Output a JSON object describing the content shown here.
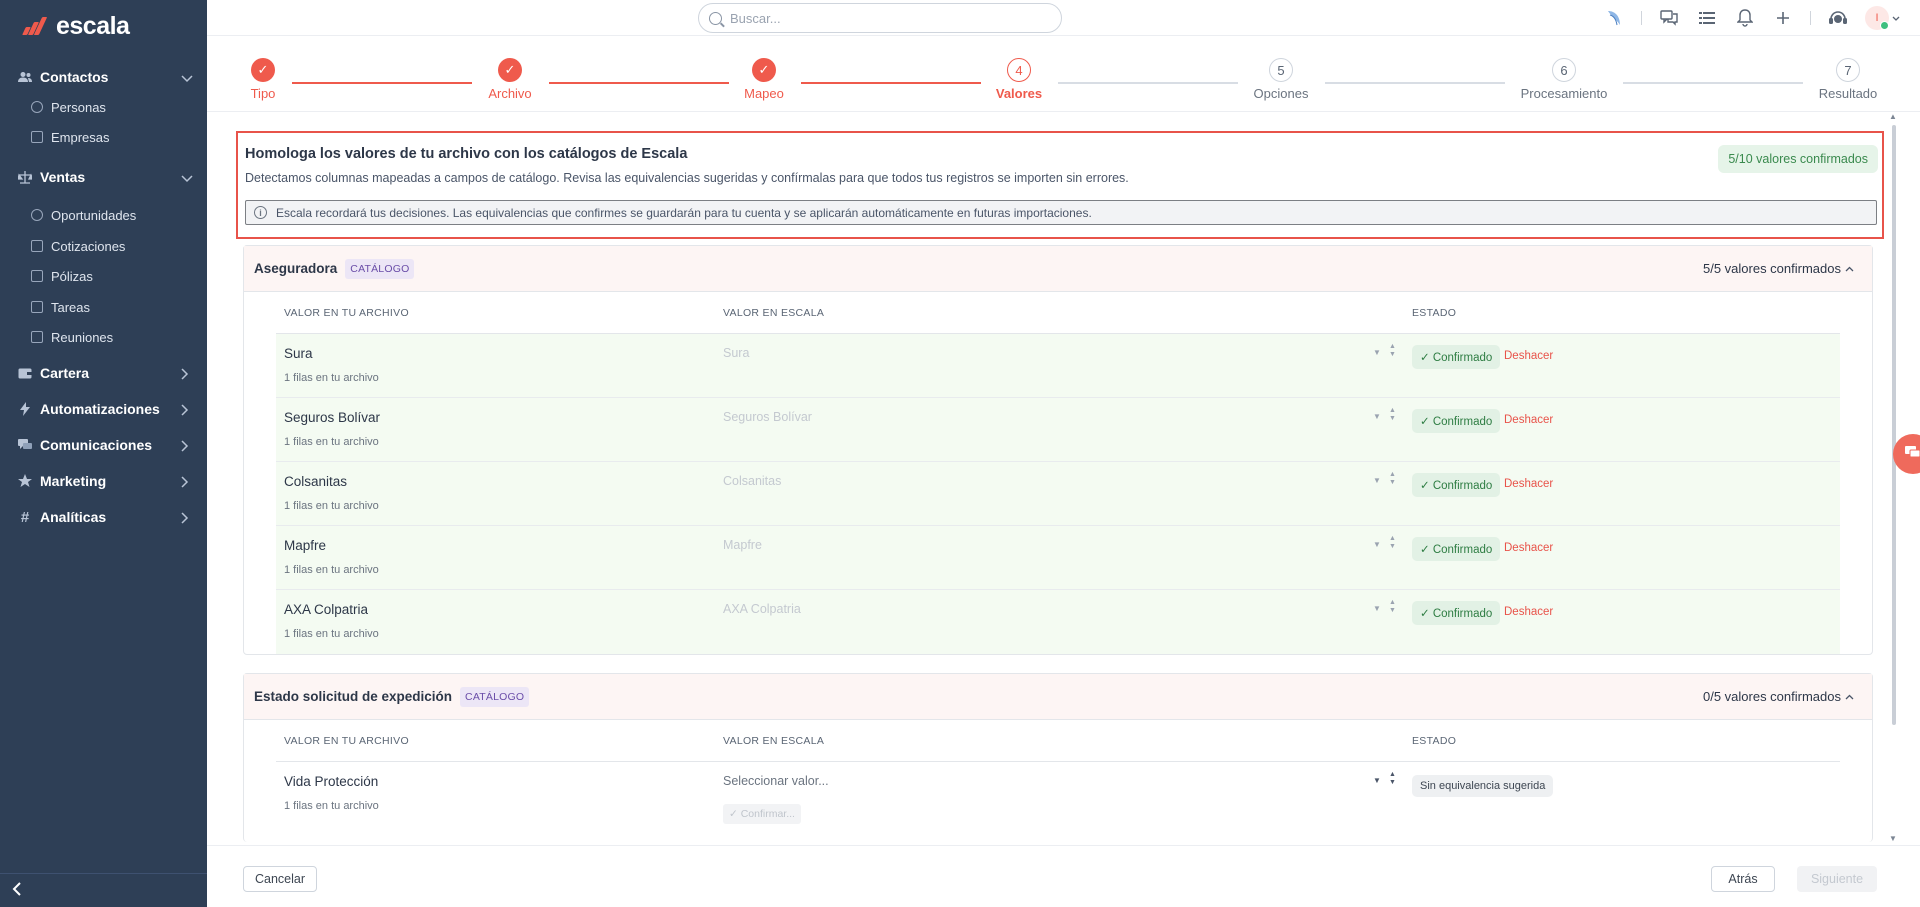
{
  "app": {
    "brand": "escala",
    "accent": "#ef5a4c",
    "sidebar_bg": "#2e3f56"
  },
  "search": {
    "placeholder": "Buscar..."
  },
  "sidebar": {
    "groups": [
      {
        "label": "Contactos",
        "icon": "users-icon",
        "expanded": true,
        "items": [
          "Personas",
          "Empresas"
        ]
      },
      {
        "label": "Ventas",
        "icon": "scale-icon",
        "expanded": true,
        "items": [
          "Oportunidades",
          "Cotizaciones",
          "Pólizas",
          "Tareas",
          "Reuniones"
        ]
      },
      {
        "label": "Cartera",
        "icon": "wallet-icon",
        "expanded": false,
        "items": []
      },
      {
        "label": "Automatizaciones",
        "icon": "bolt-icon",
        "expanded": false,
        "items": []
      },
      {
        "label": "Comunicaciones",
        "icon": "chat-icon",
        "expanded": false,
        "items": []
      },
      {
        "label": "Marketing",
        "icon": "star-icon",
        "expanded": false,
        "items": []
      },
      {
        "label": "Analíticas",
        "icon": "hash-icon",
        "expanded": false,
        "items": []
      }
    ]
  },
  "topbar": {
    "avatar_initial": "I"
  },
  "stepper": {
    "steps": [
      {
        "number": "✓",
        "label": "Tipo",
        "state": "done"
      },
      {
        "number": "✓",
        "label": "Archivo",
        "state": "done"
      },
      {
        "number": "✓",
        "label": "Mapeo",
        "state": "done"
      },
      {
        "number": "4",
        "label": "Valores",
        "state": "active"
      },
      {
        "number": "5",
        "label": "Opciones",
        "state": "todo"
      },
      {
        "number": "6",
        "label": "Procesamiento",
        "state": "todo"
      },
      {
        "number": "7",
        "label": "Resultado",
        "state": "todo"
      }
    ]
  },
  "intro": {
    "title": "Homologa los valores de tu archivo con los catálogos de Escala",
    "description": "Detectamos columnas mapeadas a campos de catálogo. Revisa las equivalencias sugeridas y confírmalas para que todos tus registros se importen sin errores.",
    "confirmed_badge": "5/10 valores confirmados",
    "info": "Escala recordará tus decisiones. Las equivalencias que confirmes se guardarán para tu cuenta y se aplicarán automáticamente en futuras importaciones."
  },
  "table_headers": {
    "file_value": "VALOR EN TU ARCHIVO",
    "escala_value": "VALOR EN ESCALA",
    "status": "ESTADO"
  },
  "sections": [
    {
      "title": "Aseguradora",
      "badge": "CATÁLOGO",
      "count": "5/5 valores confirmados",
      "rows": [
        {
          "name": "Sura",
          "rows_label": "1 filas en tu archivo",
          "escala": "Sura",
          "status": "✓ Confirmado",
          "action": "Deshacer"
        },
        {
          "name": "Seguros Bolívar",
          "rows_label": "1 filas en tu archivo",
          "escala": "Seguros Bolívar",
          "status": "✓ Confirmado",
          "action": "Deshacer"
        },
        {
          "name": "Colsanitas",
          "rows_label": "1 filas en tu archivo",
          "escala": "Colsanitas",
          "status": "✓ Confirmado",
          "action": "Deshacer"
        },
        {
          "name": "Mapfre",
          "rows_label": "1 filas en tu archivo",
          "escala": "Mapfre",
          "status": "✓ Confirmado",
          "action": "Deshacer"
        },
        {
          "name": "AXA Colpatria",
          "rows_label": "1 filas en tu archivo",
          "escala": "AXA Colpatria",
          "status": "✓ Confirmado",
          "action": "Deshacer"
        }
      ]
    },
    {
      "title": "Estado solicitud de expedición",
      "badge": "CATÁLOGO",
      "count": "0/5 valores confirmados",
      "rows": [
        {
          "name": "Vida Protección",
          "rows_label": "1 filas en tu archivo",
          "escala_placeholder": "Seleccionar valor...",
          "status": "Sin equivalencia sugerida",
          "confirm": "✓ Confirmar..."
        }
      ]
    }
  ],
  "footer": {
    "cancel": "Cancelar",
    "back": "Atrás",
    "next": "Siguiente"
  }
}
